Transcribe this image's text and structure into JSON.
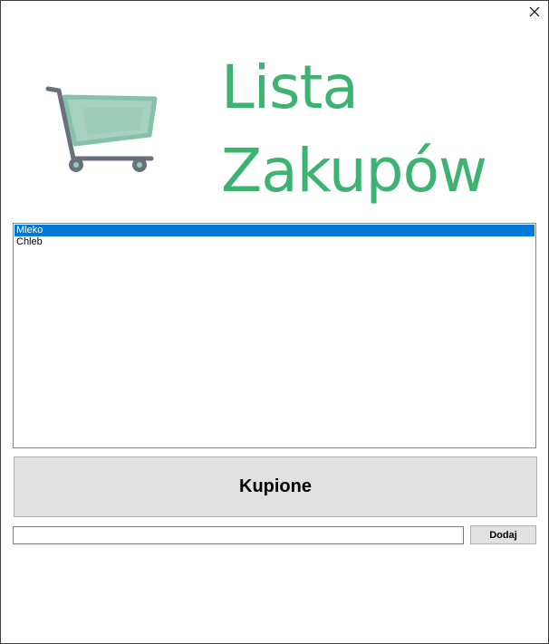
{
  "window": {
    "close_symbol": "✕"
  },
  "header": {
    "title_line1": "Lista",
    "title_line2": "Zakupów",
    "icon": "shopping-cart-icon",
    "title_color": "#3cb371"
  },
  "list": {
    "items": [
      {
        "label": "Mleko",
        "selected": true
      },
      {
        "label": "Chleb",
        "selected": false
      }
    ],
    "selection_color": "#0078d7"
  },
  "buttons": {
    "bought_label": "Kupione",
    "add_label": "Dodaj"
  },
  "input": {
    "value": "",
    "placeholder": ""
  }
}
